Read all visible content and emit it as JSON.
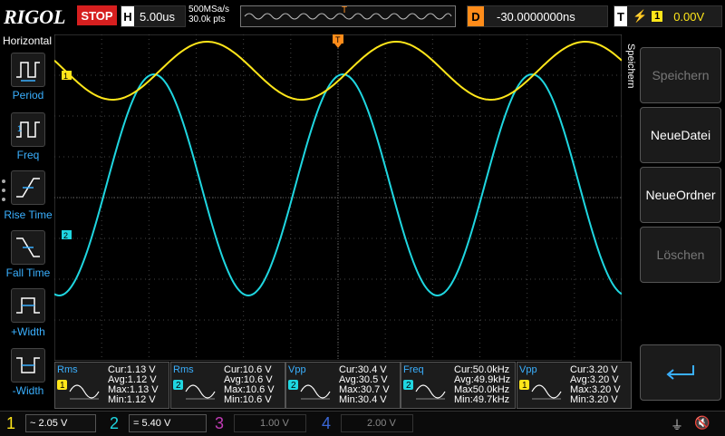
{
  "header": {
    "brand": "RIGOL",
    "run_state": "STOP",
    "timebase_label": "H",
    "timebase_value": "5.00us",
    "sample_rate": "500MSa/s",
    "memory_depth": "30.0k pts",
    "trigger_position_label": "T",
    "delay_label": "D",
    "delay_value": "-30.0000000ns",
    "trigger_label": "T",
    "trigger_source": "1",
    "trigger_level": "0.00V"
  },
  "left_menu": {
    "title": "Horizontal",
    "items": [
      {
        "label": "Period",
        "icon": "period-icon"
      },
      {
        "label": "Freq",
        "icon": "frequency-icon"
      },
      {
        "label": "Rise Time",
        "icon": "rise-time-icon"
      },
      {
        "label": "Fall Time",
        "icon": "fall-time-icon"
      },
      {
        "label": "+Width",
        "icon": "positive-width-icon"
      },
      {
        "label": "-Width",
        "icon": "negative-width-icon"
      }
    ]
  },
  "waveforms": {
    "ch1_marker": "1",
    "ch2_marker": "2",
    "trigger_marker": "T",
    "colors": {
      "ch1": "#ffe61a",
      "ch2": "#1fd6e0",
      "ch3": "#c23bb6",
      "ch4": "#3a67d6",
      "trigger": "#ff8c1a"
    }
  },
  "right_menu": {
    "title": "Speichern",
    "softkeys": [
      {
        "label": "Speichern",
        "enabled": false
      },
      {
        "label": "NeueDatei",
        "enabled": true
      },
      {
        "label": "NeueOrdner",
        "enabled": true
      },
      {
        "label": "Löschen",
        "enabled": false
      }
    ],
    "enter_icon": "enter-icon"
  },
  "measurements": [
    {
      "name": "Rms",
      "channel": "1",
      "cur": "Cur:1.13 V",
      "avg": "Avg:1.12 V",
      "max": "Max:1.13 V",
      "min": "Min:1.12 V"
    },
    {
      "name": "Rms",
      "channel": "2",
      "cur": "Cur:10.6 V",
      "avg": "Avg:10.6 V",
      "max": "Max:10.6 V",
      "min": "Min:10.6 V"
    },
    {
      "name": "Vpp",
      "channel": "2",
      "cur": "Cur:30.4 V",
      "avg": "Avg:30.5 V",
      "max": "Max:30.7 V",
      "min": "Min:30.4 V"
    },
    {
      "name": "Freq",
      "channel": "2",
      "cur": "Cur:50.0kHz",
      "avg": "Avg:49.9kHz",
      "max": "Max50.0kHz",
      "min": "Min:49.7kHz"
    },
    {
      "name": "Vpp",
      "channel": "1",
      "cur": "Cur:3.20 V",
      "avg": "Avg:3.20 V",
      "max": "Max:3.20 V",
      "min": "Min:3.20 V"
    }
  ],
  "channels": [
    {
      "num": "1",
      "coupling": "~",
      "scale": "2.05 V",
      "active": true
    },
    {
      "num": "2",
      "coupling": "=",
      "scale": "5.40 V",
      "active": true
    },
    {
      "num": "3",
      "coupling": "",
      "scale": "1.00 V",
      "active": false
    },
    {
      "num": "4",
      "coupling": "",
      "scale": "2.00 V",
      "active": false
    }
  ],
  "status_icons": [
    "usb-icon",
    "mute-icon"
  ]
}
